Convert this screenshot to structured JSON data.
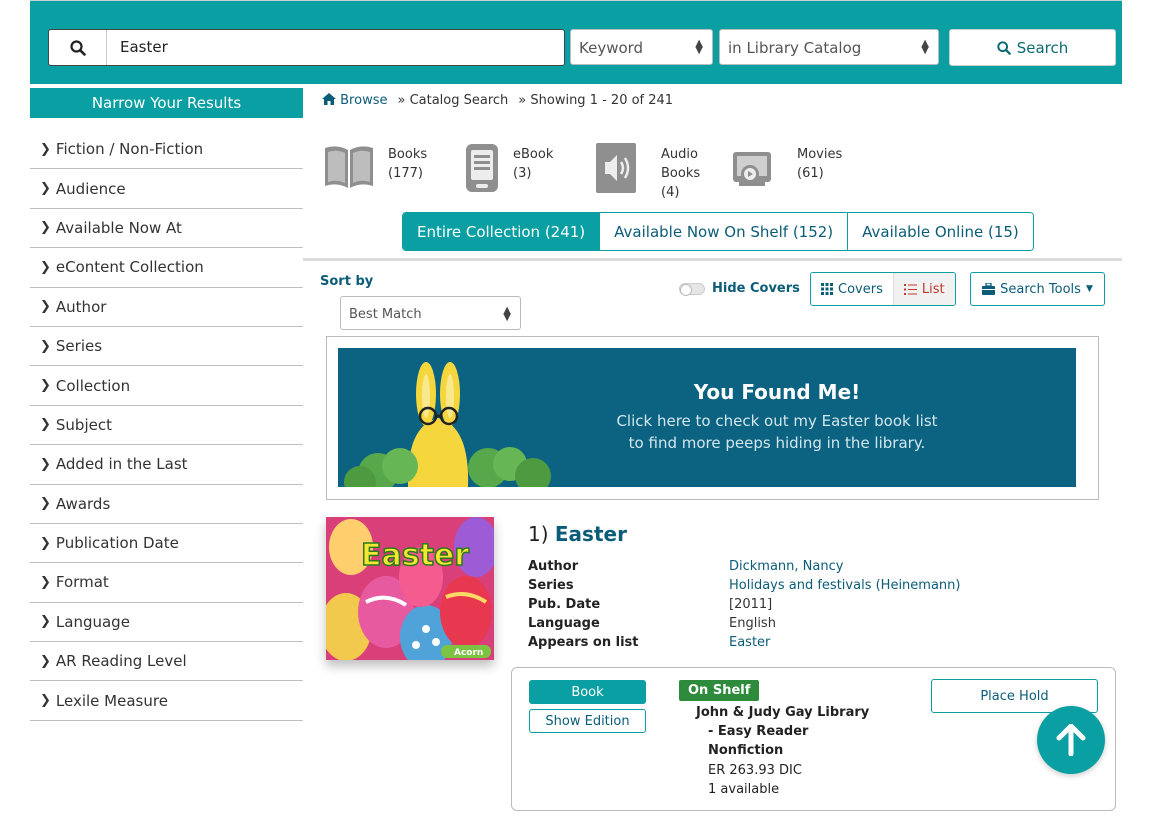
{
  "search": {
    "query": "Easter",
    "search_type": "Keyword",
    "scope": "in Library Catalog",
    "button_label": "Search"
  },
  "sidebar": {
    "header": "Narrow Your Results",
    "facets": [
      "Fiction / Non-Fiction",
      "Audience",
      "Available Now At",
      "eContent Collection",
      "Author",
      "Series",
      "Collection",
      "Subject",
      "Added in the Last",
      "Awards",
      "Publication Date",
      "Format",
      "Language",
      "AR Reading Level",
      "Lexile Measure"
    ]
  },
  "breadcrumb": {
    "browse": "Browse",
    "catalog": "» Catalog Search",
    "showing": "» Showing 1 - 20 of 241"
  },
  "formats": [
    {
      "name": "Books",
      "count": "(177)",
      "icon": "book-icon"
    },
    {
      "name": "eBook",
      "count": "(3)",
      "icon": "ereader-icon"
    },
    {
      "name": "Audio",
      "name2": "Books",
      "count": "(4)",
      "icon": "audio-icon"
    },
    {
      "name": "Movies",
      "count": "(61)",
      "icon": "movie-icon"
    }
  ],
  "tabs": [
    "Entire Collection (241)",
    "Available Now On Shelf (152)",
    "Available Online (15)"
  ],
  "toolbar": {
    "sort_label": "Sort by",
    "sort_value": "Best Match",
    "hide_covers": "Hide Covers",
    "covers": "Covers",
    "list": "List",
    "search_tools": "Search Tools"
  },
  "banner": {
    "title": "You Found Me!",
    "line1": "Click here to check out my Easter book list",
    "line2": "to find more peeps hiding in the library."
  },
  "result": {
    "number": "1)",
    "title": "Easter",
    "cover_text": "Easter",
    "cover_brand": "Acorn",
    "author_label": "Author",
    "author": "Dickmann, Nancy",
    "series_label": "Series",
    "series": "Holidays and festivals (Heinemann)",
    "pubdate_label": "Pub. Date",
    "pubdate": "[2011]",
    "language_label": "Language",
    "language": "English",
    "list_label": "Appears on list",
    "list": "Easter"
  },
  "holdings": {
    "format": "Book",
    "show_edition": "Show Edition",
    "status": "On Shelf",
    "library": "John & Judy Gay Library",
    "collection": "- Easy Reader",
    "subcollection": "Nonfiction",
    "call_number": "ER 263.93 DIC",
    "available": "1 available",
    "place_hold": "Place Hold"
  },
  "colors": {
    "teal": "#0a9fa3",
    "link": "#0b5c78",
    "banner": "#0b6281",
    "on_shelf": "#2e8b3c"
  }
}
